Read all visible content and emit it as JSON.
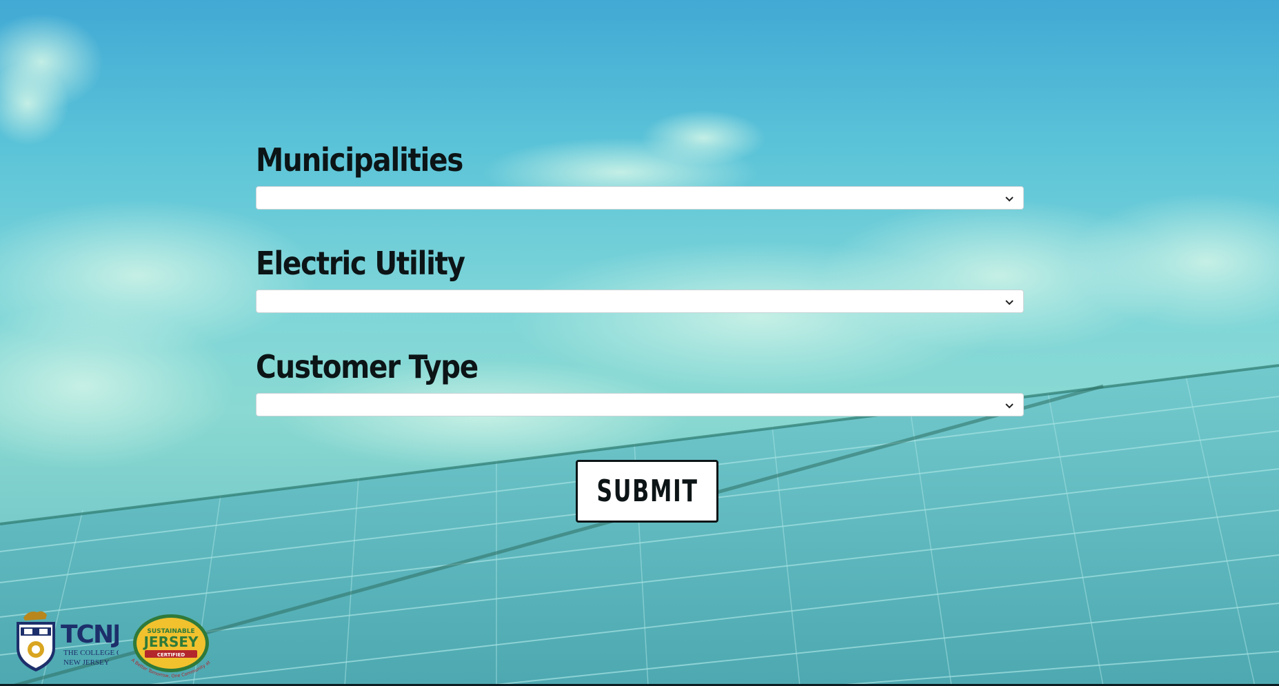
{
  "form": {
    "municipalities": {
      "label": "Municipalities",
      "value": ""
    },
    "electric_utility": {
      "label": "Electric Utility",
      "value": ""
    },
    "customer_type": {
      "label": "Customer Type",
      "value": ""
    },
    "submit_label": "SUBMIT"
  },
  "logos": {
    "tcnj": {
      "mark": "TCNJ",
      "subtitle_line1": "THE COLLEGE OF",
      "subtitle_line2": "NEW JERSEY"
    },
    "sustainable_jersey": {
      "line1": "SUSTAINABLE",
      "line2": "JERSEY",
      "line3": "CERTIFIED",
      "ring_text": "A Better Tomorrow, One Community at a Time"
    }
  },
  "colors": {
    "sky_top": "#41a9d4",
    "sky_mid": "#7fd6d8",
    "panel": "#5fb8bf",
    "label_text": "#0c1416",
    "button_bg": "#ffffff"
  },
  "icons": {
    "dropdown": "chevron-down-icon"
  }
}
